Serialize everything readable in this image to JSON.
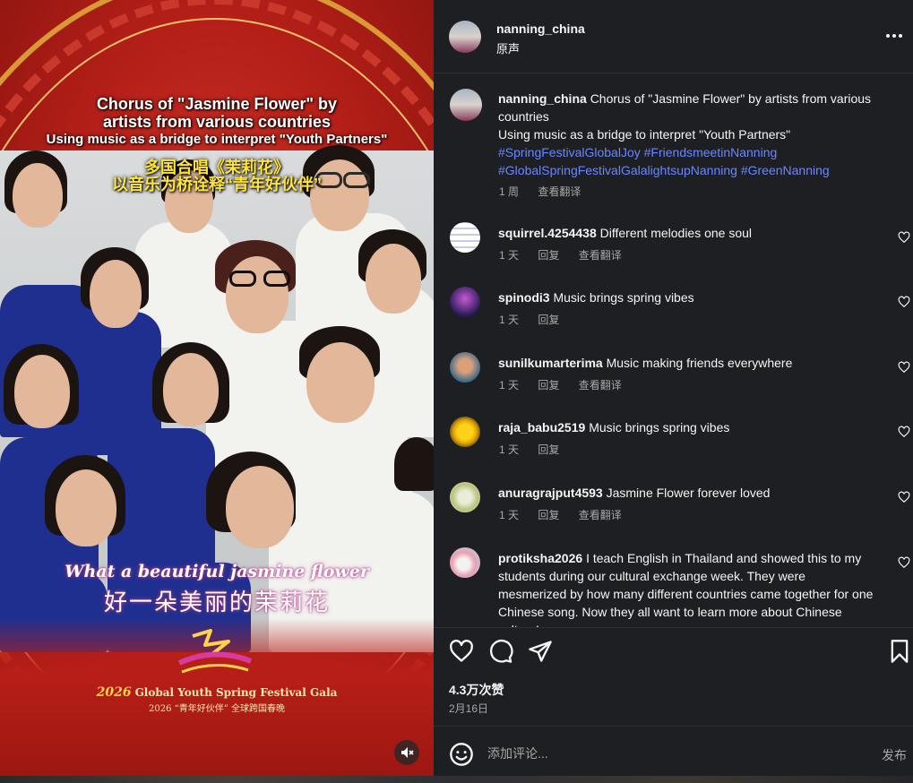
{
  "media": {
    "caption_en_line1": "Chorus of \"Jasmine Flower\" by",
    "caption_en_line2": "artists from various countries",
    "caption_en_line3": "Using music as a bridge to interpret \"Youth Partners\"",
    "caption_cn_line1": "多国合唱《茉莉花》",
    "caption_cn_line2": "以音乐为桥诠释“青年好伙伴”",
    "lyric_en": "What a beautiful jasmine flower",
    "lyric_cn": "好一朵美丽的茉莉花",
    "gala_year": "2026",
    "gala_title": "Global Youth Spring Festival Gala",
    "gala_subtitle": "2026 “青年好伙伴” 全球跨国春晚",
    "mute_icon": "speaker-muted-icon"
  },
  "header": {
    "username": "nanning_china",
    "audio": "原声",
    "more_icon": "more-horizontal-icon"
  },
  "caption": {
    "username": "nanning_china",
    "text_line1": "Chorus of \"Jasmine Flower\" by artists from various countries",
    "text_line2": "Using music as a bridge to interpret \"Youth Partners\"",
    "hashtags": "#SpringFestivalGlobalJoy #FriendsmeetinNanning #GlobalSpringFestivalGalalightsupNanning #GreenNanning",
    "time": "1 周",
    "translate": "查看翻译"
  },
  "comments": [
    {
      "username": "squirrel.4254438",
      "text": "Different melodies one soul",
      "time": "1 天",
      "reply": "回复",
      "translate": "查看翻译"
    },
    {
      "username": "spinodi3",
      "text": "Music brings spring vibes",
      "time": "1 天",
      "reply": "回复",
      "translate": ""
    },
    {
      "username": "sunilkumarterima",
      "text": "Music making friends everywhere",
      "time": "1 天",
      "reply": "回复",
      "translate": "查看翻译"
    },
    {
      "username": "raja_babu2519",
      "text": "Music brings spring vibes",
      "time": "1 天",
      "reply": "回复",
      "translate": ""
    },
    {
      "username": "anuragrajput4593",
      "text": "Jasmine Flower forever loved",
      "time": "1 天",
      "reply": "回复",
      "translate": "查看翻译"
    },
    {
      "username": "protiksha2026",
      "text": "I teach English in Thailand and showed this to my students during our cultural exchange week. They were mesmerized by how many different countries came together for one Chinese song. Now they all want to learn more about Chinese culture!",
      "time": "",
      "reply": "",
      "translate": ""
    }
  ],
  "actions": {
    "like_icon": "heart-icon",
    "comment_icon": "comment-bubble-icon",
    "share_icon": "send-icon",
    "save_icon": "bookmark-icon",
    "likes": "4.3万次赞",
    "date": "2月16日"
  },
  "composer": {
    "emoji_icon": "emoji-icon",
    "placeholder": "添加评论...",
    "post_label": "发布"
  },
  "colors": {
    "panel_bg": "#1e1f23",
    "hashtag": "#6a86ff",
    "secondary_text": "#a8a8a8",
    "media_red": "#b41f18"
  }
}
